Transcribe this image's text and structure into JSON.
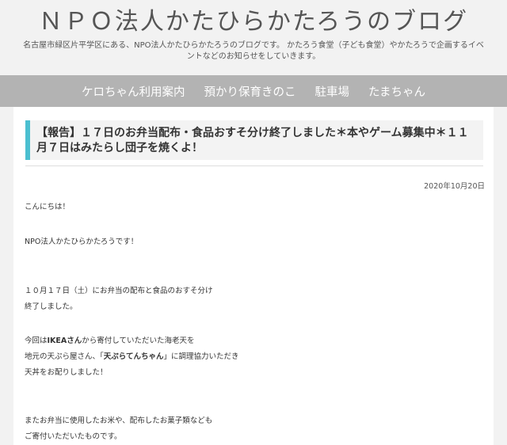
{
  "header": {
    "title": "ＮＰＯ法人かたひらかたろうのブログ",
    "description": "名古屋市緑区片平学区にある、NPO法人かたひらかたろうのブログです。 かたろう食堂（子ども食堂）やかたろうで企画するイベントなどのお知らせをしていきます。"
  },
  "nav": {
    "items": [
      {
        "label": "ケロちゃん利用案内"
      },
      {
        "label": "預かり保育きのこ"
      },
      {
        "label": "駐車場"
      },
      {
        "label": "たまちゃん"
      }
    ]
  },
  "post": {
    "title": "【報告】１７日のお弁当配布・食品おすそ分け終了しました＊本やゲーム募集中＊１１月７日はみたらし団子を焼くよ！",
    "date": "2020年10月20日",
    "paragraphs": {
      "p1": "こんにちは！",
      "p2": "NPO法人かたひらかたろうです！",
      "p3a": "１０月１７日（土）にお弁当の配布と食品のおすそ分け",
      "p3b": "終了しました。",
      "p4a_pre": "今回は",
      "p4a_bold": "IKEAさん",
      "p4a_post": "から寄付していただいた海老天を",
      "p4b_pre": "地元の天ぷら屋さん、「",
      "p4b_bold": "天ぷらてんちゃん",
      "p4b_post": "」に調理協力いただき",
      "p4c": "天丼をお配りしました！",
      "p5a": "またお弁当に使用したお米や、配布したお菓子類なども",
      "p5b": "ご寄付いただいたものです。"
    }
  }
}
